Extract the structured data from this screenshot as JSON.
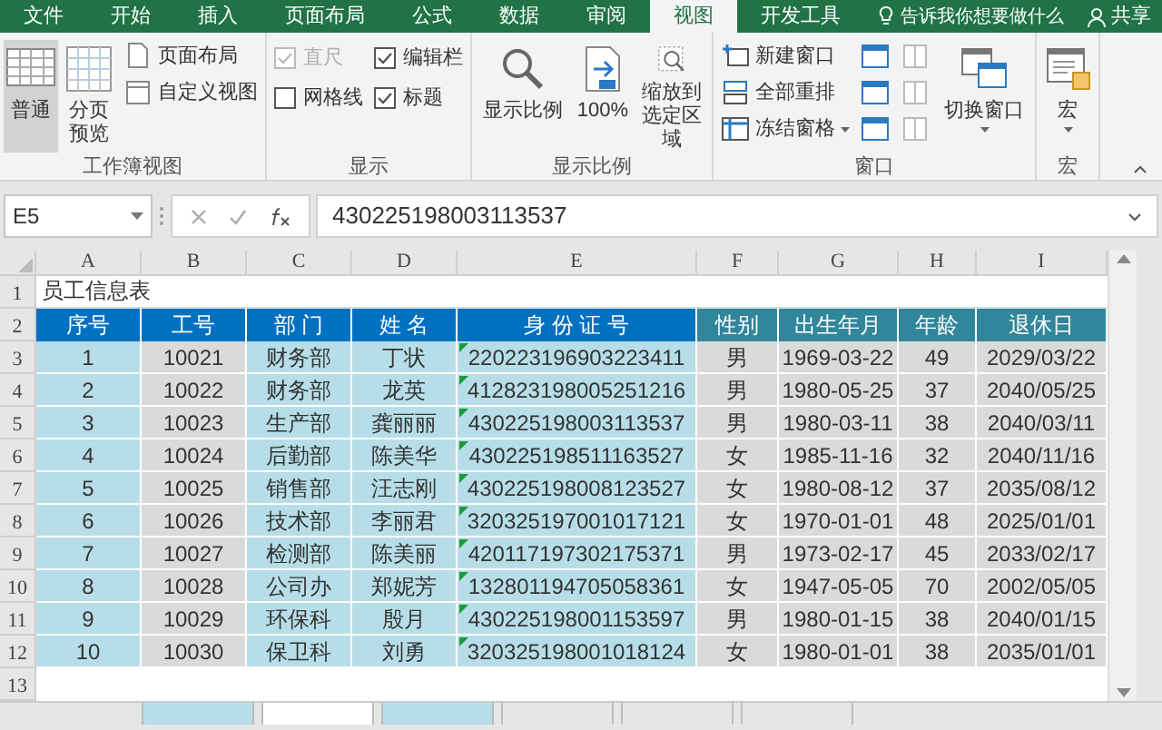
{
  "ribbon_tabs": [
    {
      "label": "文件",
      "selected": false
    },
    {
      "label": "开始",
      "selected": false
    },
    {
      "label": "插入",
      "selected": false
    },
    {
      "label": "页面布局",
      "selected": false
    },
    {
      "label": "公式",
      "selected": false
    },
    {
      "label": "数据",
      "selected": false
    },
    {
      "label": "审阅",
      "selected": false
    },
    {
      "label": "视图",
      "selected": true
    },
    {
      "label": "开发工具",
      "selected": false
    }
  ],
  "tell_me": "告诉我你想要做什么",
  "share": "共享",
  "ribbon_groups": [
    {
      "label": "工作簿视图",
      "columns": [
        [
          {
            "kind": "large",
            "label": "普通",
            "selected": true,
            "dropdown": false
          }
        ],
        [
          {
            "kind": "large",
            "label": "分页预览",
            "selected": false,
            "dropdown": false
          }
        ],
        [
          {
            "kind": "small",
            "label": "页面布局",
            "dropdown": false
          },
          {
            "kind": "small",
            "label": "自定义视图",
            "dropdown": false
          }
        ]
      ]
    },
    {
      "label": "显示",
      "columns": [
        [
          {
            "kind": "checkbox",
            "label": "直尺",
            "checked": true,
            "disabled": true
          },
          {
            "kind": "checkbox",
            "label": "网格线",
            "checked": false,
            "disabled": false
          }
        ],
        [
          {
            "kind": "checkbox",
            "label": "编辑栏",
            "checked": true,
            "disabled": false
          },
          {
            "kind": "checkbox",
            "label": "标题",
            "checked": true,
            "disabled": false
          }
        ]
      ]
    },
    {
      "label": "显示比例",
      "columns": [
        [
          {
            "kind": "large",
            "label": "显示比例",
            "selected": false,
            "dropdown": false
          }
        ],
        [
          {
            "kind": "large",
            "label": "100%",
            "selected": false,
            "dropdown": false
          }
        ],
        [
          {
            "kind": "large",
            "label": "缩放到选定区域",
            "selected": false,
            "dropdown": false
          }
        ]
      ]
    },
    {
      "label": "窗口",
      "columns": [
        [
          {
            "kind": "small",
            "label": "新建窗口",
            "dropdown": false
          },
          {
            "kind": "small",
            "label": "全部重排",
            "dropdown": false
          },
          {
            "kind": "small",
            "label": "冻结窗格",
            "dropdown": true
          }
        ],
        [
          {
            "kind": "icon"
          },
          {
            "kind": "icon"
          },
          {
            "kind": "icon"
          }
        ],
        [
          {
            "kind": "icon"
          },
          {
            "kind": "icon"
          },
          {
            "kind": "icon"
          }
        ],
        [
          {
            "kind": "large",
            "label": "切换窗口",
            "selected": false,
            "dropdown": true
          }
        ]
      ]
    },
    {
      "label": "宏",
      "columns": [
        [
          {
            "kind": "large",
            "label": "宏",
            "selected": false,
            "dropdown": true
          }
        ]
      ]
    }
  ],
  "name_box": "E5",
  "formula": "430225198003113537",
  "columns": [
    "A",
    "B",
    "C",
    "D",
    "E",
    "F",
    "G",
    "H",
    "I"
  ],
  "row_numbers": [
    "1",
    "2",
    "3",
    "4",
    "5",
    "6",
    "7",
    "8",
    "9",
    "10",
    "11",
    "12",
    "13"
  ],
  "title": "员工信息表",
  "headers": [
    "序号",
    "工号",
    "部 门",
    "姓 名",
    "身 份 证 号",
    "性别",
    "出生年月",
    "年龄",
    "退休日"
  ],
  "rows": [
    [
      "1",
      "10021",
      "财务部",
      "丁状",
      "220223196903223411",
      "男",
      "1969-03-22",
      "49",
      "2029/03/22"
    ],
    [
      "2",
      "10022",
      "财务部",
      "龙英",
      "412823198005251216",
      "男",
      "1980-05-25",
      "37",
      "2040/05/25"
    ],
    [
      "3",
      "10023",
      "生产部",
      "龚丽丽",
      "430225198003113537",
      "男",
      "1980-03-11",
      "38",
      "2040/03/11"
    ],
    [
      "4",
      "10024",
      "后勤部",
      "陈美华",
      "430225198511163527",
      "女",
      "1985-11-16",
      "32",
      "2040/11/16"
    ],
    [
      "5",
      "10025",
      "销售部",
      "汪志刚",
      "430225198008123527",
      "女",
      "1980-08-12",
      "37",
      "2035/08/12"
    ],
    [
      "6",
      "10026",
      "技术部",
      "李丽君",
      "320325197001017121",
      "女",
      "1970-01-01",
      "48",
      "2025/01/01"
    ],
    [
      "7",
      "10027",
      "检测部",
      "陈美丽",
      "420117197302175371",
      "男",
      "1973-02-17",
      "45",
      "2033/02/17"
    ],
    [
      "8",
      "10028",
      "公司办",
      "郑妮芳",
      "132801194705058361",
      "女",
      "1947-05-05",
      "70",
      "2002/05/05"
    ],
    [
      "9",
      "10029",
      "环保科",
      "殷月",
      "430225198001153597",
      "男",
      "1980-01-15",
      "38",
      "2040/01/15"
    ],
    [
      "10",
      "10030",
      "保卫科",
      "刘勇",
      "320325198001018124",
      "女",
      "1980-01-01",
      "38",
      "2035/01/01"
    ]
  ],
  "sheet_tabs": [
    {
      "selected": false,
      "color": "#b7dee8"
    },
    {
      "selected": true
    },
    {
      "selected": false,
      "color": "#b7dee8"
    },
    {
      "selected": false
    },
    {
      "selected": false
    },
    {
      "selected": false
    }
  ]
}
